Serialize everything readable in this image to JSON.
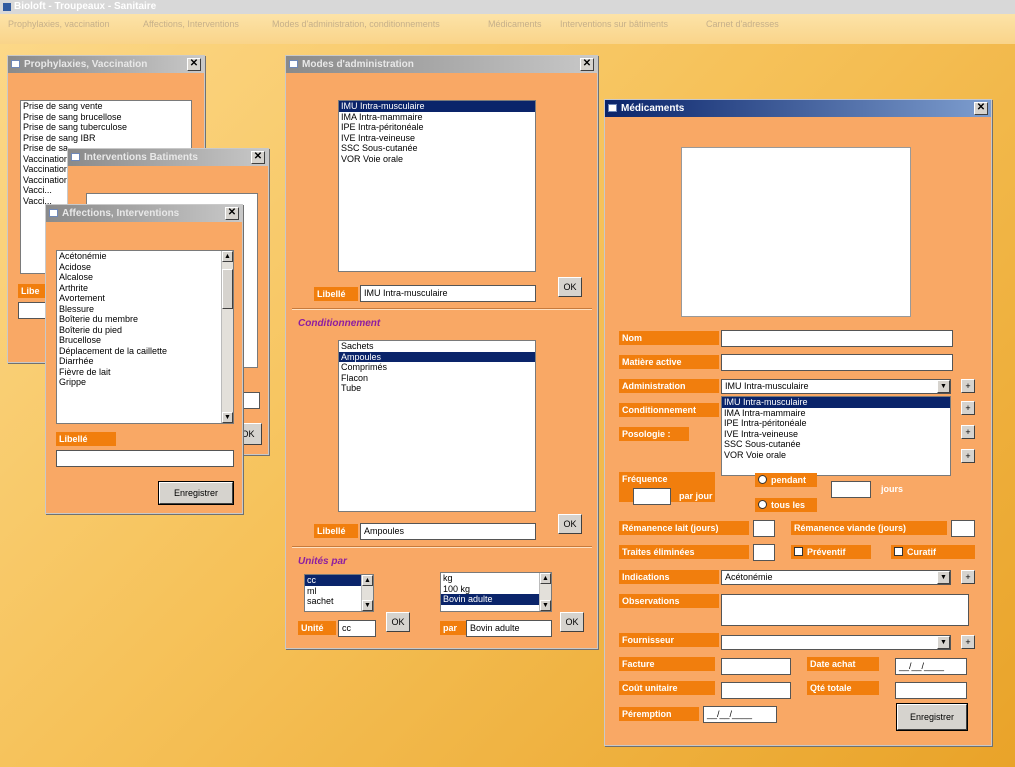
{
  "app": {
    "title": "Bioloft - Troupeaux - Sanitaire"
  },
  "menu": [
    "Prophylaxies, vaccination",
    "Affections, Interventions",
    "Modes d'administration, conditionnements",
    "Médicaments",
    "Interventions sur bâtiments",
    "Carnet d'adresses"
  ],
  "proph": {
    "title": "Prophylaxies, Vaccination",
    "items": [
      "Prise de sang vente",
      "Prise de sang brucellose",
      "Prise de sang tuberculose",
      "Prise de sang IBR",
      "Prise de sa...",
      "Vaccination",
      "Vaccination",
      "Vaccination",
      "Vacci...",
      "Vacci..."
    ],
    "libelle_label": "Libe"
  },
  "interv": {
    "title": "Interventions Batiments",
    "ok": "OK"
  },
  "aff": {
    "title": "Affections, Interventions",
    "items": [
      "Acétonémie",
      "Acidose",
      "Alcalose",
      "Arthrite",
      "Avortement",
      "Blessure",
      "Boîterie du membre",
      "Boîterie du pied",
      "Brucellose",
      "Déplacement de la caillette",
      "Diarrhée",
      "Fièvre de lait",
      "Grippe"
    ],
    "libelle_label": "Libellé",
    "libelle_value": "",
    "save": "Enregistrer"
  },
  "modes": {
    "title": "Modes d'administration",
    "admin_items": [
      "IMU Intra-musculaire",
      "IMA Intra-mammaire",
      "IPE Intra-péritonéale",
      "IVE Intra-veineuse",
      "SSC Sous-cutanée",
      "VOR Voie orale"
    ],
    "admin_libelle_label": "Libellé",
    "admin_libelle_value": "IMU Intra-musculaire",
    "ok": "OK",
    "cond_title": "Conditionnement",
    "cond_items": [
      "Sachets",
      "Ampoules",
      "Comprimés",
      "Flacon",
      "Tube"
    ],
    "cond_libelle_label": "Libellé",
    "cond_libelle_value": "Ampoules",
    "unit_title": "Unités par",
    "unit_items": [
      "cc",
      "ml",
      "sachet"
    ],
    "per_items": [
      "kg",
      "100 kg",
      "Bovin adulte"
    ],
    "unite_label": "Unité",
    "unite_value": "cc",
    "par_label": "par",
    "par_value": "Bovin adulte"
  },
  "med": {
    "title": "Médicaments",
    "nom_label": "Nom",
    "matiere_label": "Matière active",
    "admin_label": "Administration",
    "admin_value": "IMU Intra-musculaire",
    "admin_options": [
      "IMU Intra-musculaire",
      "IMA Intra-mammaire",
      "IPE Intra-péritonéale",
      "IVE Intra-veineuse",
      "SSC Sous-cutanée",
      "VOR Voie orale"
    ],
    "cond_label": "Conditionnement",
    "poso_label": "Posologie :",
    "freq_label": "Fréquence",
    "par_jour": "par jour",
    "opt_pendant": "pendant",
    "opt_tous": "tous les",
    "jours": "jours",
    "rem_lait": "Rémanence lait (jours)",
    "rem_viande": "Rémanence viande (jours)",
    "traites": "Traites éliminées",
    "preventif": "Préventif",
    "curatif": "Curatif",
    "indications_label": "Indications",
    "indications_value": "Acétonémie",
    "observations_label": "Observations",
    "fournisseur_label": "Fournisseur",
    "facture_label": "Facture",
    "date_achat_label": "Date achat",
    "date_achat_value": "__/__/____",
    "cout_label": "Coût unitaire",
    "qte_label": "Qté totale",
    "peremption_label": "Péremption",
    "peremption_value": "__/__/____",
    "save": "Enregistrer"
  }
}
